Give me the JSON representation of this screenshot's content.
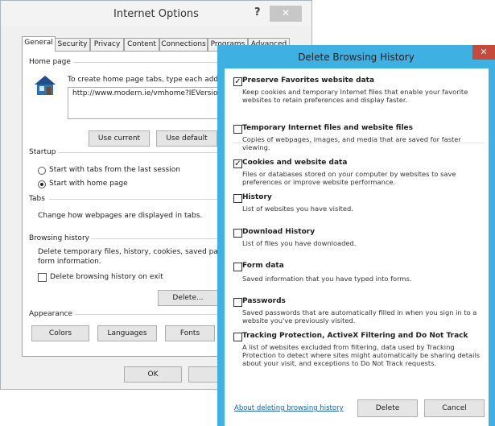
{
  "internet_options": {
    "title": "Internet Options",
    "help_label": "?",
    "close_label": "✕",
    "tabs": [
      "General",
      "Security",
      "Privacy",
      "Content",
      "Connections",
      "Programs",
      "Advanced"
    ],
    "home_page": {
      "group_label": "Home page",
      "instruction": "To create home page tabs, type each address",
      "url": "http://www.modern.ie/vmhome?IEVersion",
      "use_current": "Use current",
      "use_default": "Use default"
    },
    "startup": {
      "group_label": "Startup",
      "option1": "Start with tabs from the last session",
      "option2": "Start with home page",
      "selected": "Start with home page"
    },
    "tabs_group": {
      "group_label": "Tabs",
      "text": "Change how webpages are displayed in tabs."
    },
    "browsing_history": {
      "group_label": "Browsing history",
      "text_line1": "Delete temporary files, history, cookies, saved passw",
      "text_line2": "form information.",
      "checkbox_label": "Delete browsing history on exit",
      "delete_button": "Delete..."
    },
    "appearance": {
      "group_label": "Appearance",
      "colors": "Colors",
      "languages": "Languages",
      "fonts": "Fonts"
    },
    "ok": "OK",
    "cancel": "Canc"
  },
  "delete_browsing_history": {
    "title": "Delete Browsing History",
    "close_label": "✕",
    "options": [
      {
        "title": "Preserve Favorites website data",
        "desc": "Keep cookies and temporary Internet files that enable your favorite websites to retain preferences and display faster.",
        "checked": true
      },
      {
        "title": "Temporary Internet files and website files",
        "desc": "Copies of webpages, images, and media that are saved for faster viewing.",
        "checked": false
      },
      {
        "title": "Cookies and website data",
        "desc": "Files or databases stored on your computer by websites to save preferences or improve website performance.",
        "checked": true
      },
      {
        "title": "History",
        "desc": "List of websites you have visited.",
        "checked": false
      },
      {
        "title": "Download History",
        "desc": "List of files you have downloaded.",
        "checked": false
      },
      {
        "title": "Form data",
        "desc": "Saved information that you have typed into forms.",
        "checked": false
      },
      {
        "title": "Passwords",
        "desc": "Saved passwords that are automatically filled in when you sign in to a website you've previously visited.",
        "checked": false
      },
      {
        "title": "Tracking Protection, ActiveX Filtering and Do Not Track",
        "desc": "A list of websites excluded from filtering, data used by Tracking Protection to detect where sites might automatically be sharing details about your visit, and exceptions to Do Not Track requests.",
        "checked": false
      }
    ],
    "check_mark": "✓",
    "about_link": "About deleting browsing history",
    "delete_button": "Delete",
    "cancel_button": "Cancel"
  }
}
